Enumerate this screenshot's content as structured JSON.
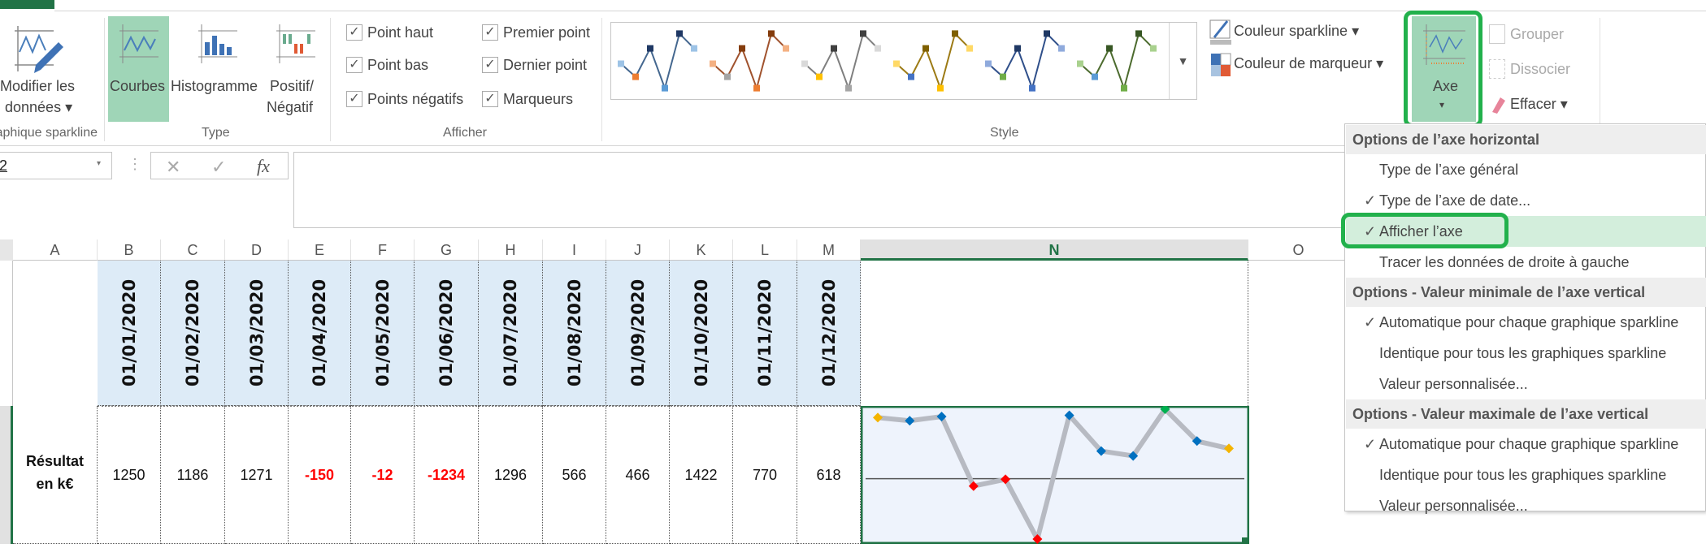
{
  "ribbon": {
    "groups": {
      "sparkline": "Graphique sparkline",
      "type": "Type",
      "show": "Afficher",
      "style": "Style"
    },
    "edit_data": {
      "line1": "Modifier les",
      "line2": "données ▾"
    },
    "types": [
      {
        "label": "Courbes",
        "selected": true
      },
      {
        "label": "Histogramme",
        "selected": false
      },
      {
        "label1": "Positif/",
        "label2": "Négatif",
        "selected": false
      }
    ],
    "show": [
      {
        "label": "Point haut",
        "checked": true
      },
      {
        "label": "Point bas",
        "checked": true
      },
      {
        "label": "Points négatifs",
        "checked": true
      },
      {
        "label": "Premier point",
        "checked": true
      },
      {
        "label": "Dernier point",
        "checked": true
      },
      {
        "label": "Marqueurs",
        "checked": true
      }
    ],
    "styles": [
      {
        "line": "#44678f",
        "first": "#9dc3e6",
        "high": "#1f3864",
        "low": "#5b9bd5",
        "last": "#9dc3e6",
        "neg": "#ed7d31"
      },
      {
        "line": "#a0522d",
        "first": "#f4b183",
        "high": "#843c0c",
        "low": "#ed7d31",
        "last": "#f4b183",
        "neg": "#a5a5a5"
      },
      {
        "line": "#7f7f7f",
        "first": "#d9d9d9",
        "high": "#404040",
        "low": "#a5a5a5",
        "last": "#d9d9d9",
        "neg": "#ffc000"
      },
      {
        "line": "#9c7a14",
        "first": "#ffd966",
        "high": "#7f6000",
        "low": "#ffc000",
        "last": "#ffd966",
        "neg": "#4472c4"
      },
      {
        "line": "#2f4f8a",
        "first": "#8faadc",
        "high": "#1f3864",
        "low": "#4472c4",
        "last": "#8faadc",
        "neg": "#70ad47"
      },
      {
        "line": "#4c6b2e",
        "first": "#a9d18e",
        "high": "#375623",
        "low": "#70ad47",
        "last": "#a9d18e",
        "neg": "#5b9bd5"
      }
    ],
    "sparkline_color": "Couleur sparkline ▾",
    "marker_color": "Couleur de marqueur ▾",
    "axis": {
      "label": "Axe",
      "arrow": "▾"
    },
    "group": "Grouper",
    "ungroup": "Dissocier",
    "clear": "Effacer ▾"
  },
  "formula_bar": {
    "name_box": "2",
    "cancel": "✕",
    "enter": "✓",
    "fx": "fx",
    "value": ""
  },
  "columns": [
    "A",
    "B",
    "C",
    "D",
    "E",
    "F",
    "G",
    "H",
    "I",
    "J",
    "K",
    "L",
    "M",
    "N",
    "O"
  ],
  "row1_dates": [
    "01/01/2020",
    "01/02/2020",
    "01/03/2020",
    "01/04/2020",
    "01/05/2020",
    "01/06/2020",
    "01/07/2020",
    "01/08/2020",
    "01/09/2020",
    "01/10/2020",
    "01/11/2020",
    "01/12/2020"
  ],
  "row2": {
    "label1": "Résultat",
    "label2": "en k€",
    "values": [
      "1250",
      "1186",
      "1271",
      "-150",
      "-12",
      "-1234",
      "1296",
      "566",
      "466",
      "1422",
      "770",
      "618"
    ]
  },
  "sparkline": {
    "type": "line",
    "values": [
      1250,
      1186,
      1271,
      -150,
      -12,
      -1234,
      1296,
      566,
      466,
      1422,
      770,
      618
    ],
    "show_axis": true,
    "colors": {
      "line": "#b7bac2",
      "marker": "#0070c0",
      "first": "#f4b400",
      "last": "#f4b400",
      "high": "#00b050",
      "low": "#ff0000",
      "negative": "#ff0000",
      "axis": "#555555",
      "background": "#eef3fc"
    }
  },
  "axis_menu": {
    "sections": [
      {
        "header": "Options de l’axe horizontal",
        "items": [
          {
            "label": "Type de l’axe général",
            "checked": false
          },
          {
            "label": "Type de l’axe de date...",
            "checked": true
          },
          {
            "label": "Afficher l’axe",
            "checked": true,
            "highlighted": true
          },
          {
            "label": "Tracer les données de droite à gauche",
            "checked": false
          }
        ]
      },
      {
        "header": "Options - Valeur minimale de l’axe vertical",
        "items": [
          {
            "label": "Automatique pour chaque graphique sparkline",
            "checked": true
          },
          {
            "label": "Identique pour tous les graphiques sparkline",
            "checked": false
          },
          {
            "label": "Valeur personnalisée...",
            "checked": false
          }
        ]
      },
      {
        "header": "Options - Valeur maximale de l’axe vertical",
        "items": [
          {
            "label": "Automatique pour chaque graphique sparkline",
            "checked": true
          },
          {
            "label": "Identique pour tous les graphiques sparkline",
            "checked": false
          },
          {
            "label": "Valeur personnalisée...",
            "checked": false
          }
        ]
      }
    ],
    "check_glyph": "✓"
  },
  "annotation_color": "#22b14c"
}
